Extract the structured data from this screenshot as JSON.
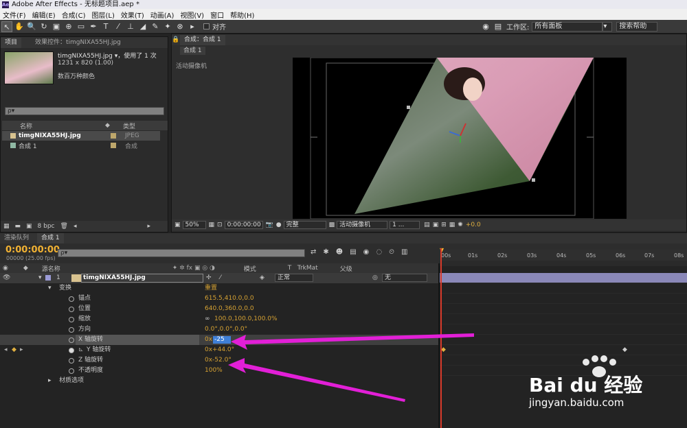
{
  "window": {
    "title": "Adobe After Effects - 无标题项目.aep *",
    "logo": "Ae"
  },
  "menu": [
    "文件(F)",
    "编辑(E)",
    "合成(C)",
    "图层(L)",
    "效果(T)",
    "动画(A)",
    "视图(V)",
    "窗口",
    "帮助(H)"
  ],
  "toolbar": {
    "align_label": "对齐",
    "workspace_label": "工作区:",
    "workspace_value": "所有面板",
    "search_help": "搜索帮助"
  },
  "project": {
    "tabs": [
      "项目",
      "效果控件：timgNIXA55HJ.jpg"
    ],
    "item_name": "timgNIXA55HJ.jpg ▾，使用了 1 次",
    "item_size": "1231 x 820 (1.00)",
    "item_color": "数百万种颜色",
    "search_placeholder": "ρ▾",
    "columns": {
      "name": "名称",
      "type": "类型"
    },
    "items": [
      {
        "name": "timgNIXA55HJ.jpg",
        "type": "JPEG"
      },
      {
        "name": "合成 1",
        "type": "合成"
      }
    ],
    "bpc": "8 bpc"
  },
  "composition": {
    "tab": "合成：合成 1",
    "subtab": "合成 1",
    "camera_label": "活动摄像机",
    "zoom": "50%",
    "timecode": "0:00:00:00",
    "quality": "完整",
    "camera": "活动摄像机",
    "views": "1 ...",
    "exposure": "+0.0"
  },
  "timeline": {
    "tabs": [
      "渲染队列",
      "合成 1"
    ],
    "time": "0:00:00:00",
    "fps": "00000 (25.00 fps)",
    "search_placeholder": "ρ▾",
    "columns": {
      "source": "源名称",
      "mode": "模式",
      "t": "T",
      "trkmat": "TrkMat",
      "parent": "父级"
    },
    "layer": {
      "num": "1",
      "name": "timgNIXA55HJ.jpg",
      "mode": "正常",
      "parent": "无"
    },
    "transform_label": "变换",
    "reset_label": "重置",
    "props": [
      {
        "name": "锚点",
        "value": "615.5,410.0,0.0"
      },
      {
        "name": "位置",
        "value": "640.0,360.0,0.0"
      },
      {
        "name": "缩放",
        "value": "100.0,100.0,100.0%"
      },
      {
        "name": "方向",
        "value": "0.0°,0.0°,0.0°"
      },
      {
        "name": "X 轴旋转",
        "prefix": "0x",
        "value": "-25"
      },
      {
        "name": "Y 轴旋转",
        "value": "0x+44.0°"
      },
      {
        "name": "Z 轴旋转",
        "value": "0x-52.0°"
      },
      {
        "name": "不透明度",
        "value": "100%"
      }
    ],
    "material_label": "材质选项",
    "ruler": [
      "00s",
      "01s",
      "02s",
      "03s",
      "04s",
      "05s",
      "06s",
      "07s",
      "08s"
    ]
  },
  "watermark": {
    "brand": "Bai du 经验",
    "url": "jingyan.baidu.com"
  },
  "colors": {
    "accent": "#d6a233",
    "arrow": "#e21fd7",
    "keyframe": "#e35a48"
  }
}
